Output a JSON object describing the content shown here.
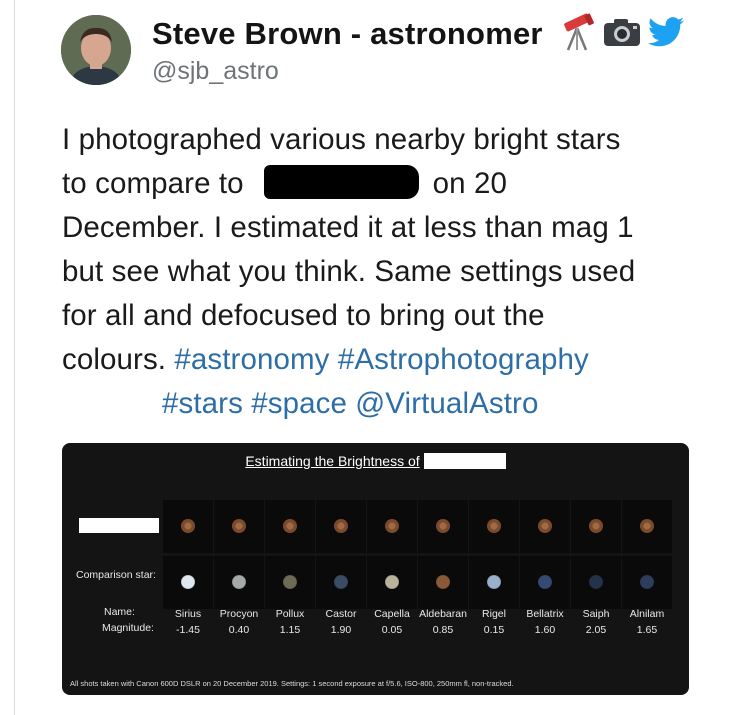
{
  "author": {
    "display_name": "Steve Brown - astronomer",
    "handle": "@sjb_astro",
    "badges": [
      "telescope-emoji",
      "camera-emoji",
      "twitter-bird-emoji"
    ]
  },
  "tweet": {
    "line1": "I photographed various nearby bright stars",
    "line2_pre": "to compare to",
    "line2_post": "on 20",
    "line3": "December. I estimated it at less than mag 1",
    "line4": "but see what you think. Same settings used",
    "line5": "for all and defocused to bring out the",
    "line6_pre": "colours.",
    "hashtags": [
      "#astronomy",
      "#Astrophotography",
      "#stars",
      "#space",
      "@VirtualAstro"
    ]
  },
  "card": {
    "title": "Estimating the Brightness of",
    "comparison_label": "Comparison star:",
    "name_label": "Name:",
    "magnitude_label": "Magnitude:",
    "footer": "All shots taken with Canon 600D DSLR on 20 December 2019. Settings: 1 second exposure at f/5.6, ISO-800, 250mm fl, non-tracked.",
    "stars": [
      {
        "name": "Sirius",
        "magnitude": "-1.45",
        "color": "#dfe8ee"
      },
      {
        "name": "Procyon",
        "magnitude": "0.40",
        "color": "#a4aaa8"
      },
      {
        "name": "Pollux",
        "magnitude": "1.15",
        "color": "#6e6a55"
      },
      {
        "name": "Castor",
        "magnitude": "1.90",
        "color": "#3a4c66"
      },
      {
        "name": "Capella",
        "magnitude": "0.05",
        "color": "#b9b39c"
      },
      {
        "name": "Aldebaran",
        "magnitude": "0.85",
        "color": "#8a5a38"
      },
      {
        "name": "Rigel",
        "magnitude": "0.15",
        "color": "#98b0c8"
      },
      {
        "name": "Bellatrix",
        "magnitude": "1.60",
        "color": "#344a72"
      },
      {
        "name": "Saiph",
        "magnitude": "2.05",
        "color": "#24324a"
      },
      {
        "name": "Alnilam",
        "magnitude": "1.65",
        "color": "#2c3e5c"
      }
    ],
    "target_color": "#7a4a2c"
  }
}
